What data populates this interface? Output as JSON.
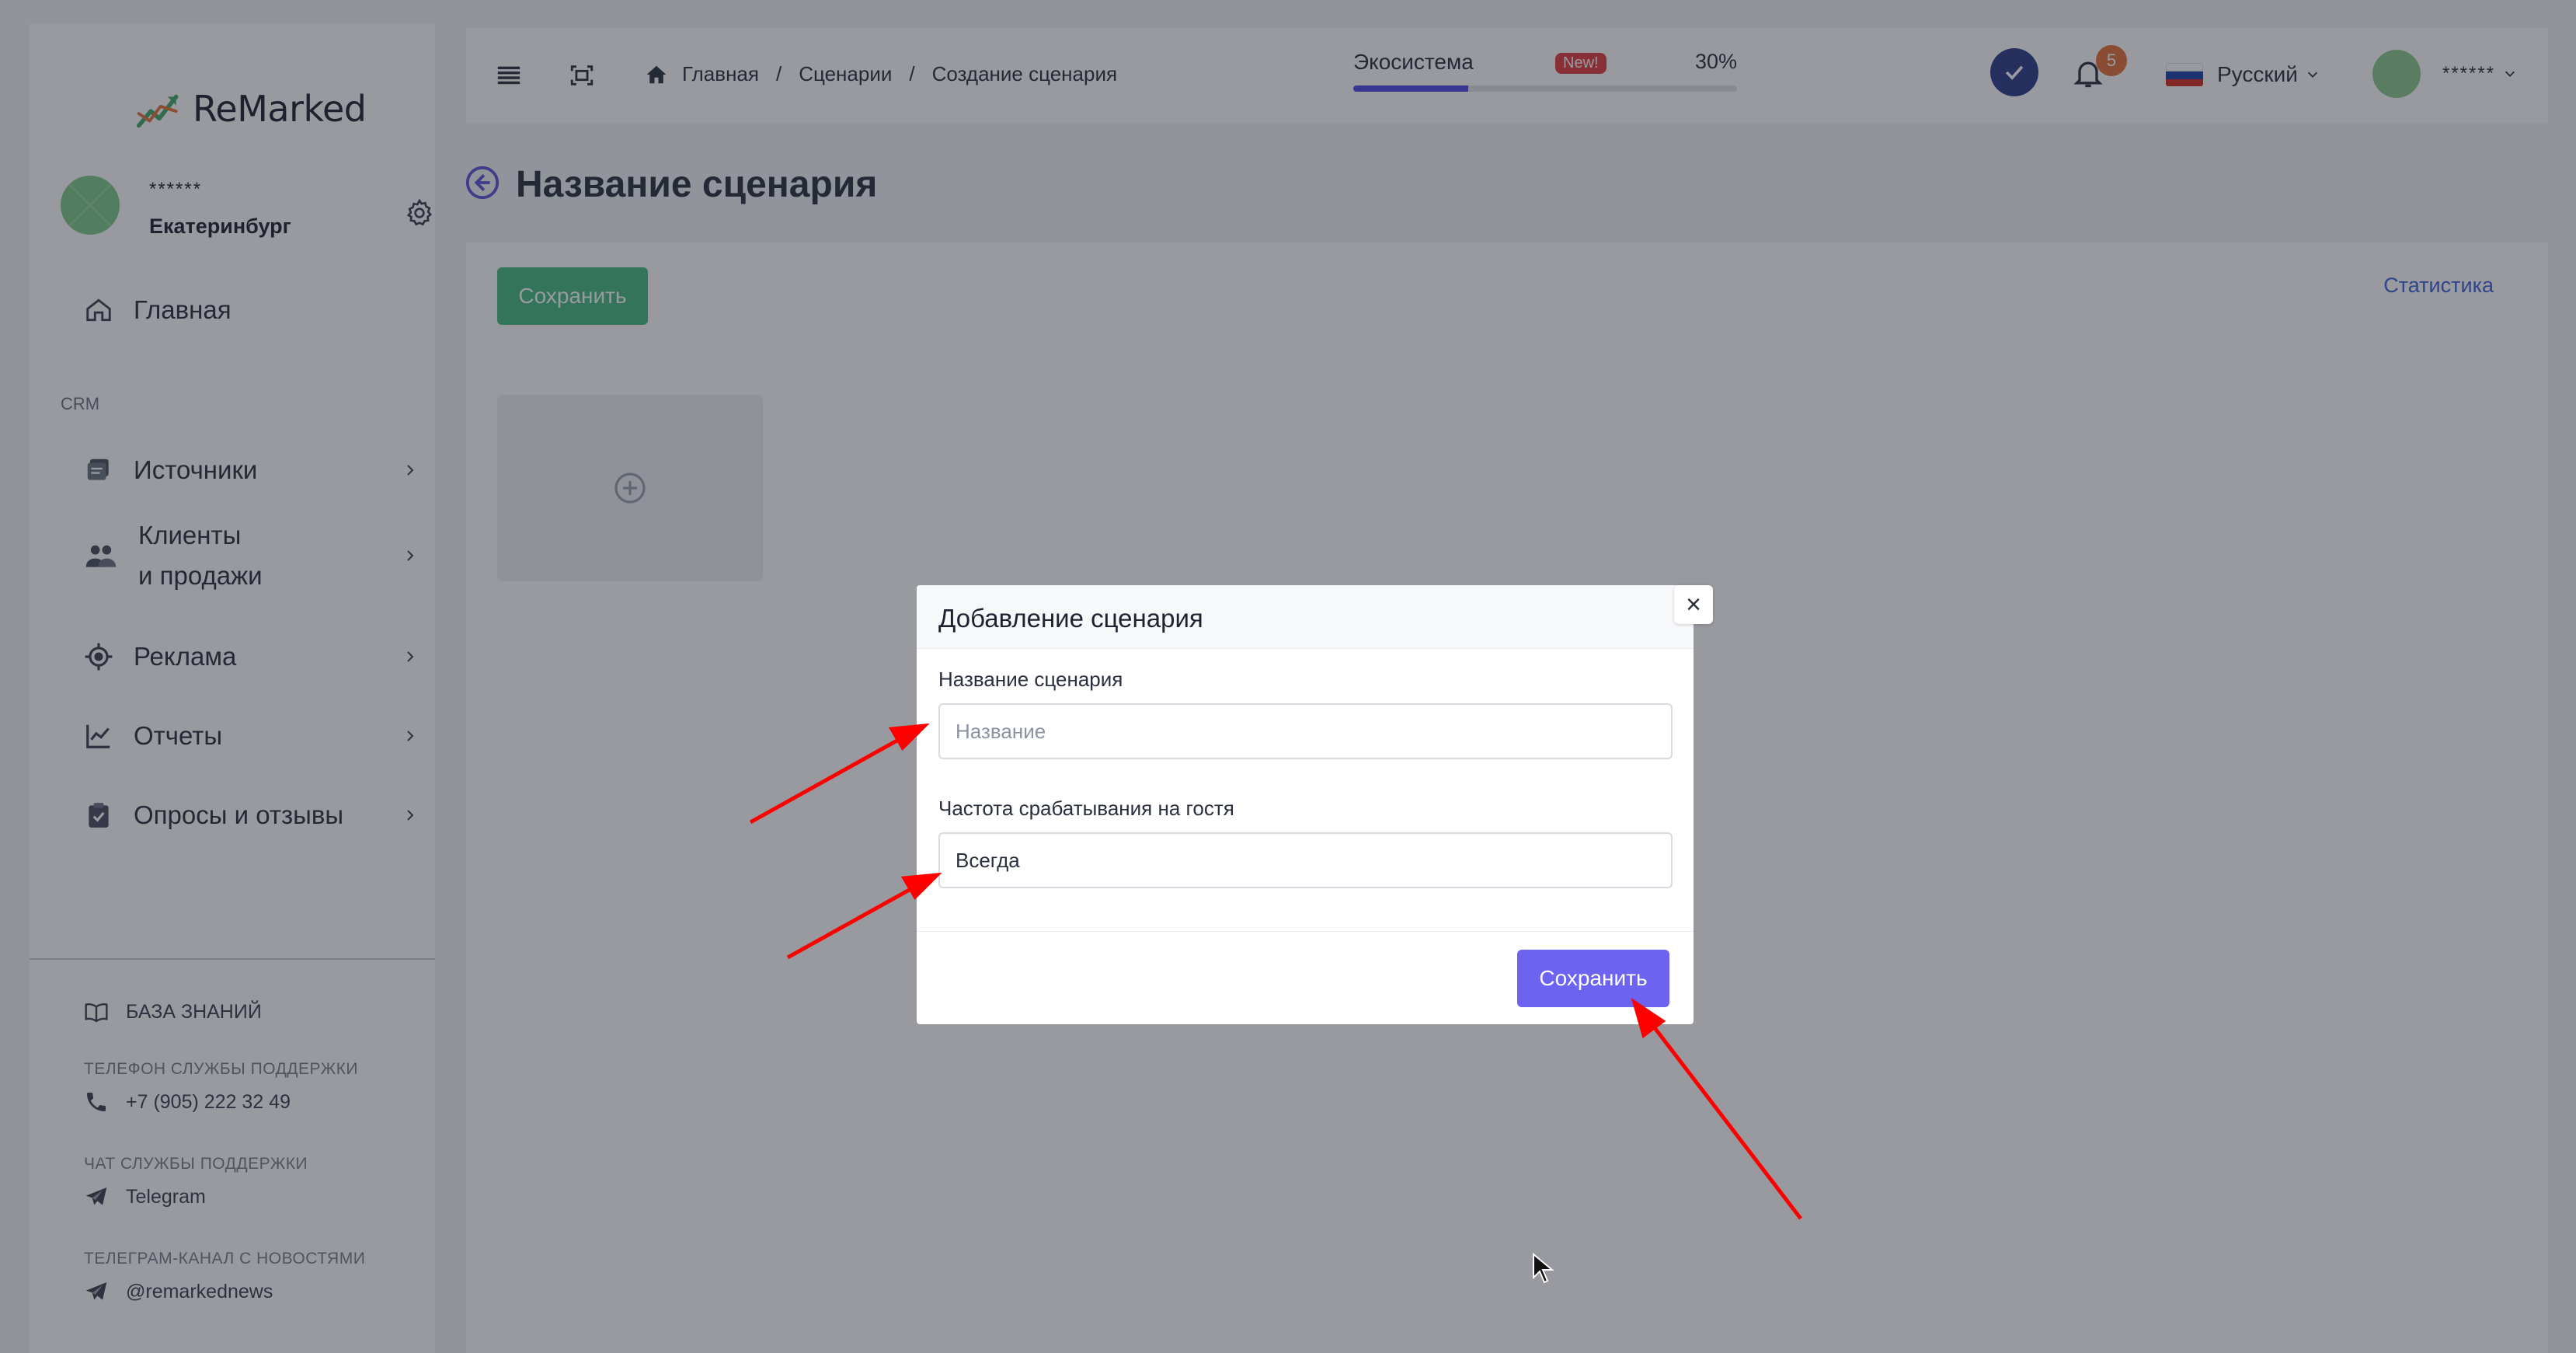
{
  "app": {
    "logo_text": "ReMarked"
  },
  "sidebar": {
    "user_name": "******",
    "user_city": "Екатеринбург",
    "items": [
      {
        "label": "Главная",
        "icon": "home-icon"
      }
    ],
    "crm_caption": "CRM",
    "crm_items": [
      {
        "label": "Источники",
        "icon": "sources-icon"
      },
      {
        "label_line1": "Клиенты",
        "label_line2": "и продажи",
        "icon": "users-icon"
      },
      {
        "label": "Реклама",
        "icon": "target-icon"
      },
      {
        "label": "Отчеты",
        "icon": "chart-icon"
      },
      {
        "label": "Опросы и отзывы",
        "icon": "clipboard-icon"
      }
    ],
    "knowledge_base": "БАЗА ЗНАНИЙ",
    "support_phone_caption": "ТЕЛЕФОН СЛУЖБЫ ПОДДЕРЖКИ",
    "support_phone": "+7 (905) 222 32 49",
    "support_chat_caption": "ЧАТ СЛУЖБЫ ПОДДЕРЖКИ",
    "support_chat": "Telegram",
    "news_caption": "ТЕЛЕГРАМ-КАНАЛ С НОВОСТЯМИ",
    "news_channel": "@remarkednews"
  },
  "topbar": {
    "breadcrumb": [
      "Главная",
      "Сценарии",
      "Создание сценария"
    ],
    "breadcrumb_sep": "/",
    "ecosystem_label": "Экосистема",
    "ecosystem_badge": "New!",
    "ecosystem_percent": "30%",
    "ecosystem_progress": 0.3,
    "notifications_count": "5",
    "language": "Русский",
    "user_name": "******"
  },
  "page": {
    "title": "Название сценария",
    "save_label": "Сохранить",
    "stats_link": "Статистика"
  },
  "modal": {
    "title": "Добавление сценария",
    "close_symbol": "×",
    "name_label": "Название сценария",
    "name_placeholder": "Название",
    "name_value": "",
    "frequency_label": "Частота срабатывания на гостя",
    "frequency_value": "Всегда",
    "save_label": "Сохранить"
  },
  "colors": {
    "green_button": "#46b980",
    "purple_button": "#6c63f0",
    "accent_link": "#3b64d6",
    "annotation_arrow": "#ff0000",
    "badge_new": "#e23b3b",
    "badge_count": "#e8703a"
  }
}
